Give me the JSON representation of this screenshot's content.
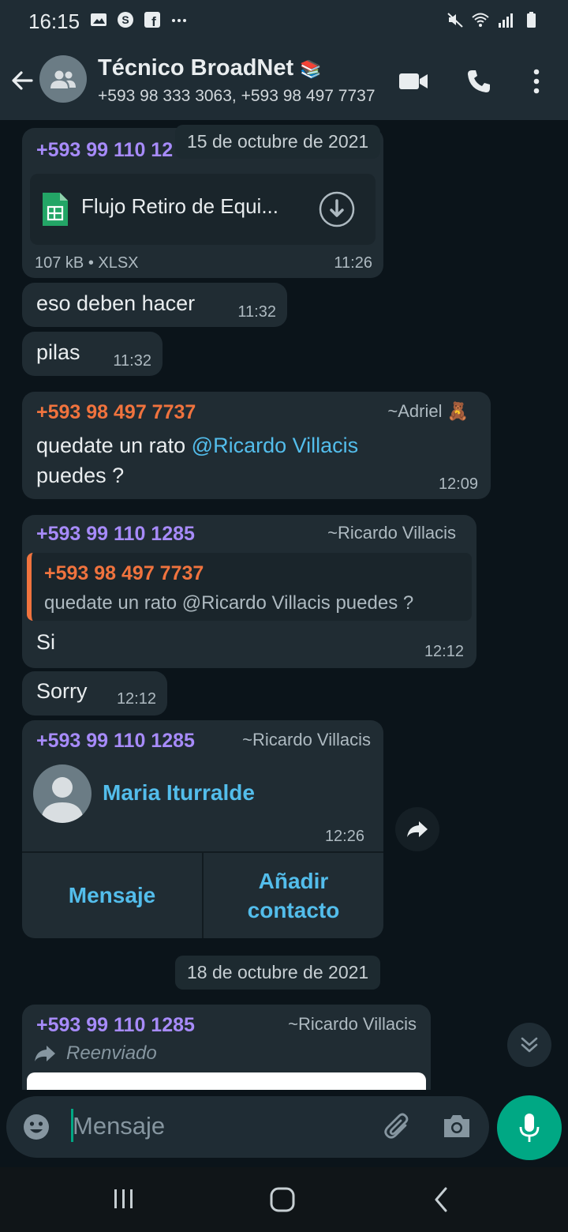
{
  "status": {
    "time": "16:15"
  },
  "header": {
    "title": "Técnico BroadNet",
    "title_emoji": "📚",
    "subtitle": "+593 98 333 3063, +593 98 497 7737"
  },
  "messages": {
    "m1": {
      "sender": "+593 99 110 12",
      "file_name": "Flujo Retiro de Equi...",
      "file_meta": "107 kB • XLSX",
      "time": "11:26"
    },
    "m2": {
      "text": "eso deben hacer",
      "time": "11:32"
    },
    "m3": {
      "text": "pilas",
      "time": "11:32"
    },
    "m4": {
      "sender": "+593 98 497 7737",
      "alias": "~Adriel 🧸",
      "text_before": "quedate un rato ",
      "mention": "@Ricardo Villacis",
      "text_after": "puedes ?",
      "time": "12:09"
    },
    "m5": {
      "sender": "+593 99 110 1285",
      "alias": "~Ricardo Villacis",
      "quote_sender": "+593 98 497 7737",
      "quote_text": "quedate un rato @Ricardo Villacis  puedes ?",
      "text": "Si",
      "time": "12:12"
    },
    "m6": {
      "text": "Sorry",
      "time": "12:12"
    },
    "m7": {
      "sender": "+593 99 110 1285",
      "alias": "~Ricardo Villacis",
      "contact_name": "Maria Iturralde",
      "time": "12:26",
      "btn_message": "Mensaje",
      "btn_add_line1": "Añadir",
      "btn_add_line2": "contacto"
    },
    "m8": {
      "sender": "+593 99 110 1285",
      "alias": "~Ricardo Villacis",
      "forwarded": "Reenviado"
    }
  },
  "dates": {
    "d1": "15 de octubre de 2021",
    "d2": "18 de octubre de 2021"
  },
  "composer": {
    "placeholder": "Mensaje"
  },
  "colors": {
    "accent": "#00a884",
    "header_bg": "#1f2c34",
    "bubble_bg": "#202c33",
    "chat_bg": "#0b141a",
    "mention": "#53bdeb"
  }
}
